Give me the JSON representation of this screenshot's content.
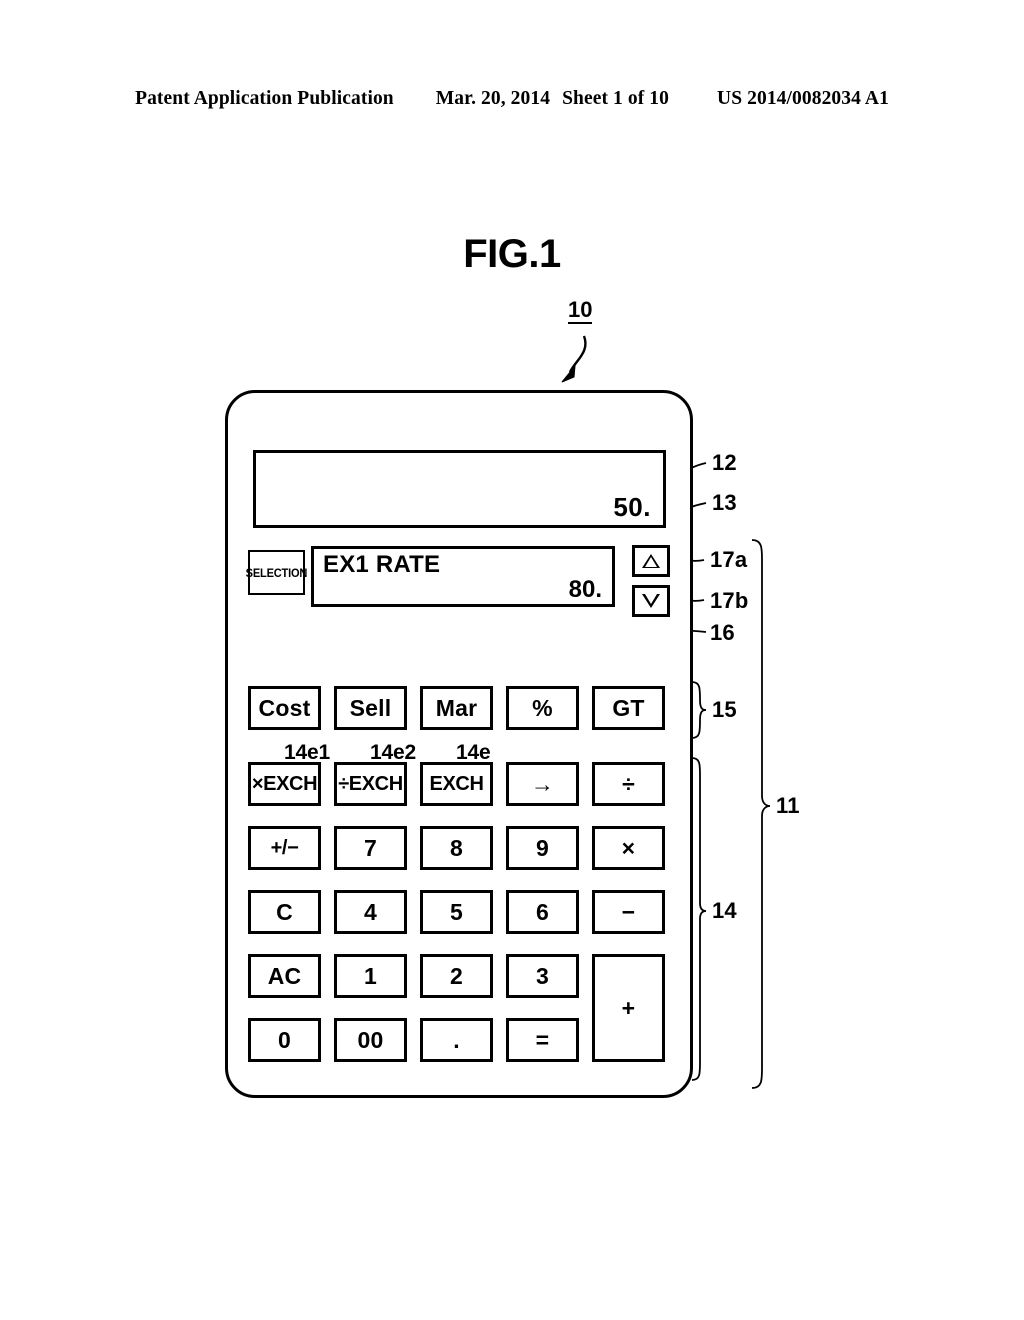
{
  "header": {
    "publication": "Patent Application Publication",
    "date": "Mar. 20, 2014",
    "sheet": "Sheet 1 of 10",
    "number": "US 2014/0082034 A1"
  },
  "figure": {
    "title": "FIG.1",
    "device_ref": "10"
  },
  "device": {
    "main_display": {
      "ref": "12",
      "value": "50."
    },
    "sub_display": {
      "ref": "13",
      "label": "EX1 RATE",
      "value": "80."
    },
    "selection_key": {
      "ref": "16",
      "label": "SELECTION"
    },
    "arrow_keys": [
      {
        "ref": "17a",
        "icon": "triangle-up-icon",
        "glyph": "△"
      },
      {
        "ref": "17b",
        "icon": "triangle-down-icon",
        "glyph": "▽"
      }
    ],
    "function_row": {
      "ref": "15",
      "keys": [
        "Cost",
        "Sell",
        "Mar",
        "%",
        "GT"
      ]
    },
    "keypad": {
      "ref": "14",
      "rows": [
        [
          "×EXCH",
          "÷EXCH",
          "EXCH",
          "→",
          "÷"
        ],
        [
          "+/−",
          "7",
          "8",
          "9",
          "×"
        ],
        [
          "C",
          "4",
          "5",
          "6",
          "−"
        ],
        [
          "AC",
          "1",
          "2",
          "3",
          "+"
        ],
        [
          "0",
          "00",
          ".",
          "=",
          ""
        ]
      ],
      "exch_refs": [
        "14e1",
        "14e2",
        "14e"
      ]
    },
    "panel_ref": "11"
  }
}
